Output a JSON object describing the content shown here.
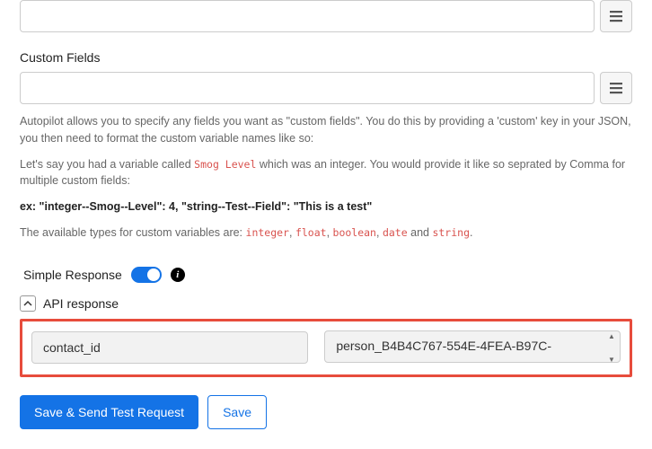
{
  "top_field": {
    "value": ""
  },
  "custom_fields": {
    "label": "Custom Fields",
    "value": "",
    "help1": "Autopilot allows you to specify any fields you want as \"custom fields\". You do this by providing a 'custom' key in your JSON, you then need to format the custom variable names like so:",
    "help2_pre": "Let's say you had a variable called ",
    "help2_code": "Smog Level",
    "help2_post": " which was an integer. You would provide it like so seprated by Comma for multiple custom fields:",
    "example": "ex: \"integer--Smog--Level\": 4, \"string--Test--Field\": \"This is a test\"",
    "types_pre": "The available types for custom variables are: ",
    "types": [
      "integer",
      "float",
      "boolean",
      "date"
    ],
    "types_sep": ", ",
    "types_and": " and ",
    "types_last": "string",
    "types_post": "."
  },
  "simple_response": {
    "label": "Simple Response",
    "on": true
  },
  "api_response": {
    "label": "API response",
    "key": "contact_id",
    "value": "person_B4B4C767-554E-4FEA-B97C-"
  },
  "buttons": {
    "primary": "Save & Send Test Request",
    "secondary": "Save"
  }
}
